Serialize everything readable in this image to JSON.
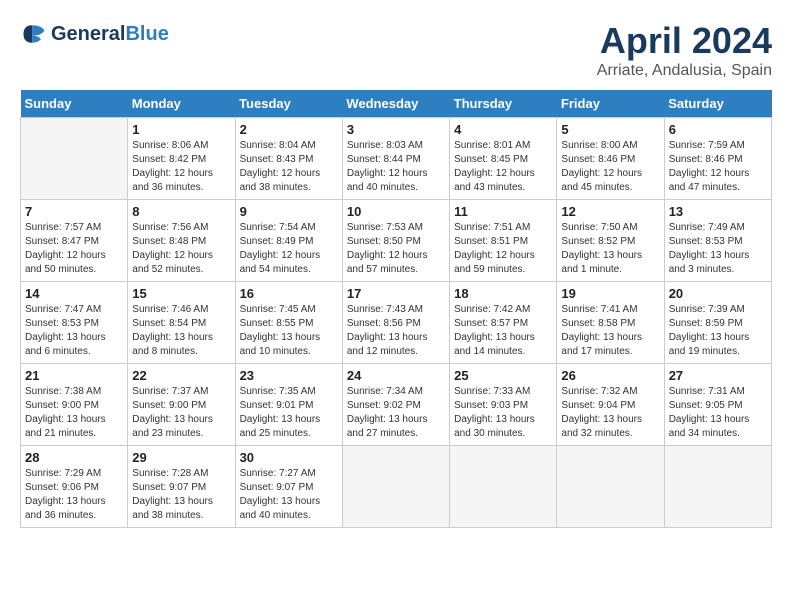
{
  "header": {
    "logo_line1": "General",
    "logo_line2": "Blue",
    "title": "April 2024",
    "subtitle": "Arriate, Andalusia, Spain"
  },
  "weekdays": [
    "Sunday",
    "Monday",
    "Tuesday",
    "Wednesday",
    "Thursday",
    "Friday",
    "Saturday"
  ],
  "weeks": [
    [
      {
        "day": "",
        "empty": true
      },
      {
        "day": "1",
        "rise": "8:06 AM",
        "set": "8:42 PM",
        "daylight": "12 hours and 36 minutes."
      },
      {
        "day": "2",
        "rise": "8:04 AM",
        "set": "8:43 PM",
        "daylight": "12 hours and 38 minutes."
      },
      {
        "day": "3",
        "rise": "8:03 AM",
        "set": "8:44 PM",
        "daylight": "12 hours and 40 minutes."
      },
      {
        "day": "4",
        "rise": "8:01 AM",
        "set": "8:45 PM",
        "daylight": "12 hours and 43 minutes."
      },
      {
        "day": "5",
        "rise": "8:00 AM",
        "set": "8:46 PM",
        "daylight": "12 hours and 45 minutes."
      },
      {
        "day": "6",
        "rise": "7:59 AM",
        "set": "8:46 PM",
        "daylight": "12 hours and 47 minutes."
      }
    ],
    [
      {
        "day": "7",
        "rise": "7:57 AM",
        "set": "8:47 PM",
        "daylight": "12 hours and 50 minutes."
      },
      {
        "day": "8",
        "rise": "7:56 AM",
        "set": "8:48 PM",
        "daylight": "12 hours and 52 minutes."
      },
      {
        "day": "9",
        "rise": "7:54 AM",
        "set": "8:49 PM",
        "daylight": "12 hours and 54 minutes."
      },
      {
        "day": "10",
        "rise": "7:53 AM",
        "set": "8:50 PM",
        "daylight": "12 hours and 57 minutes."
      },
      {
        "day": "11",
        "rise": "7:51 AM",
        "set": "8:51 PM",
        "daylight": "12 hours and 59 minutes."
      },
      {
        "day": "12",
        "rise": "7:50 AM",
        "set": "8:52 PM",
        "daylight": "13 hours and 1 minute."
      },
      {
        "day": "13",
        "rise": "7:49 AM",
        "set": "8:53 PM",
        "daylight": "13 hours and 3 minutes."
      }
    ],
    [
      {
        "day": "14",
        "rise": "7:47 AM",
        "set": "8:53 PM",
        "daylight": "13 hours and 6 minutes."
      },
      {
        "day": "15",
        "rise": "7:46 AM",
        "set": "8:54 PM",
        "daylight": "13 hours and 8 minutes."
      },
      {
        "day": "16",
        "rise": "7:45 AM",
        "set": "8:55 PM",
        "daylight": "13 hours and 10 minutes."
      },
      {
        "day": "17",
        "rise": "7:43 AM",
        "set": "8:56 PM",
        "daylight": "13 hours and 12 minutes."
      },
      {
        "day": "18",
        "rise": "7:42 AM",
        "set": "8:57 PM",
        "daylight": "13 hours and 14 minutes."
      },
      {
        "day": "19",
        "rise": "7:41 AM",
        "set": "8:58 PM",
        "daylight": "13 hours and 17 minutes."
      },
      {
        "day": "20",
        "rise": "7:39 AM",
        "set": "8:59 PM",
        "daylight": "13 hours and 19 minutes."
      }
    ],
    [
      {
        "day": "21",
        "rise": "7:38 AM",
        "set": "9:00 PM",
        "daylight": "13 hours and 21 minutes."
      },
      {
        "day": "22",
        "rise": "7:37 AM",
        "set": "9:00 PM",
        "daylight": "13 hours and 23 minutes."
      },
      {
        "day": "23",
        "rise": "7:35 AM",
        "set": "9:01 PM",
        "daylight": "13 hours and 25 minutes."
      },
      {
        "day": "24",
        "rise": "7:34 AM",
        "set": "9:02 PM",
        "daylight": "13 hours and 27 minutes."
      },
      {
        "day": "25",
        "rise": "7:33 AM",
        "set": "9:03 PM",
        "daylight": "13 hours and 30 minutes."
      },
      {
        "day": "26",
        "rise": "7:32 AM",
        "set": "9:04 PM",
        "daylight": "13 hours and 32 minutes."
      },
      {
        "day": "27",
        "rise": "7:31 AM",
        "set": "9:05 PM",
        "daylight": "13 hours and 34 minutes."
      }
    ],
    [
      {
        "day": "28",
        "rise": "7:29 AM",
        "set": "9:06 PM",
        "daylight": "13 hours and 36 minutes."
      },
      {
        "day": "29",
        "rise": "7:28 AM",
        "set": "9:07 PM",
        "daylight": "13 hours and 38 minutes."
      },
      {
        "day": "30",
        "rise": "7:27 AM",
        "set": "9:07 PM",
        "daylight": "13 hours and 40 minutes."
      },
      {
        "day": "",
        "empty": true
      },
      {
        "day": "",
        "empty": true
      },
      {
        "day": "",
        "empty": true
      },
      {
        "day": "",
        "empty": true
      }
    ]
  ],
  "labels": {
    "sunrise": "Sunrise:",
    "sunset": "Sunset:",
    "daylight": "Daylight:"
  }
}
